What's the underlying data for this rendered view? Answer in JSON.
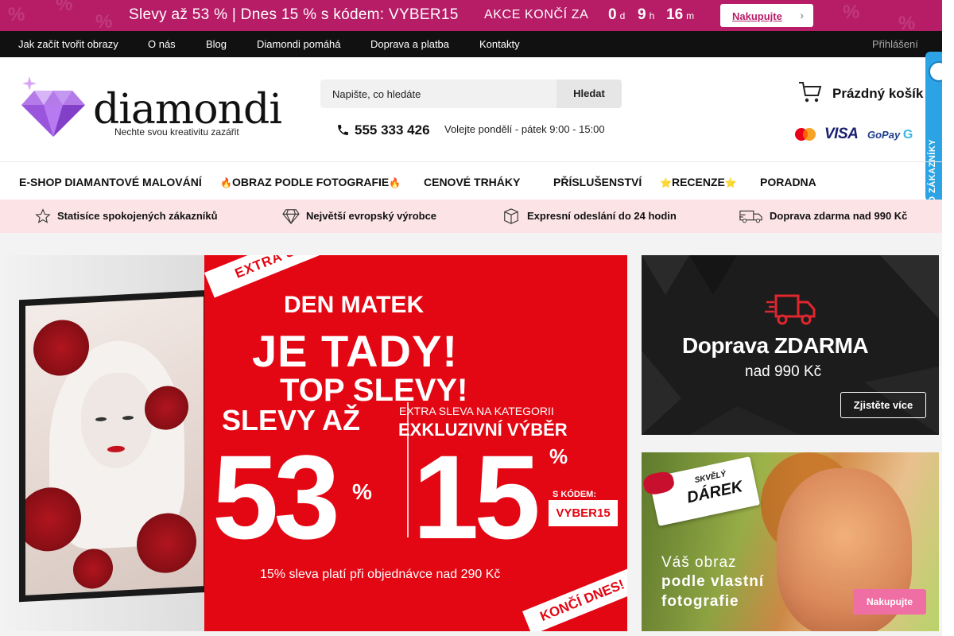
{
  "promo": {
    "text": "Slevy až 53 % | Dnes 15 % s kódem: VYBER15",
    "ends_label": "AKCE KONČÍ ZA",
    "days": "0",
    "days_unit": "d",
    "hours": "9",
    "hours_unit": "h",
    "minutes": "16",
    "minutes_unit": "m",
    "button": "Nakupujte",
    "accent": "#b71d67"
  },
  "topnav": {
    "items": [
      "Jak začít tvořit obrazy",
      "O nás",
      "Blog",
      "Diamondi pomáhá",
      "Doprava a platba",
      "Kontakty"
    ],
    "login": "Přihlášení"
  },
  "header": {
    "logo": "diamondi",
    "tagline": "Nechte svou kreativitu zazářit",
    "search_placeholder": "Napište, co hledáte",
    "search_button": "Hledat",
    "phone": "555 333 426",
    "hours": "Volejte pondělí - pátek 9:00 - 15:00",
    "cart": "Prázdný košík",
    "payments": {
      "visa": "VISA",
      "gopay": "GoPay",
      "gpay": "G"
    },
    "badge": "OVĚŘENO ZÁKAZNÍKY"
  },
  "catnav": {
    "items": [
      "E-SHOP DIAMANTOVÉ MALOVÁNÍ",
      "OBRAZ PODLE FOTOGRAFIE",
      "CENOVÉ TRHÁKY",
      "PŘÍSLUŠENSTVÍ",
      "RECENZE",
      "PORADNA"
    ],
    "fire": "🔥",
    "star": "⭐"
  },
  "usp": {
    "items": [
      {
        "label": "Statisíce spokojených zákazníků",
        "icon": "star-icon"
      },
      {
        "label": "Největší evropský výrobce",
        "icon": "diamond-icon"
      },
      {
        "label": "Expresní odeslání do 24 hodin",
        "icon": "box-icon"
      },
      {
        "label": "Doprava zdarma nad 990 Kč",
        "icon": "truck-icon"
      }
    ]
  },
  "banner": {
    "ribbon_top": "EXTRA SLEVY",
    "line1": "DEN MATEK",
    "line2": "JE TADY!",
    "line3": "TOP SLEVY!",
    "slevy_az": "SLEVY AŽ",
    "big1": "53",
    "pct": "%",
    "extra_line1": "EXTRA SLEVA NA KATEGORII",
    "extra_line2": "EXKLUZIVNÍ VÝBĚR",
    "big2": "15",
    "code_label": "S KÓDEM:",
    "code": "VYBER15",
    "note": "15% sleva platí při objednávce nad 290 Kč",
    "ribbon_bottom": "KONČÍ DNES!"
  },
  "side1": {
    "title": "Doprava ZDARMA",
    "subtitle": "nad  990 Kč",
    "button": "Zjistěte více"
  },
  "side2": {
    "tag_small": "SKVĚLÝ",
    "tag_big": "DÁREK",
    "line1": "Váš obraz",
    "line2": "podle vlastní",
    "line3": "fotografie",
    "button": "Nakupujte"
  }
}
